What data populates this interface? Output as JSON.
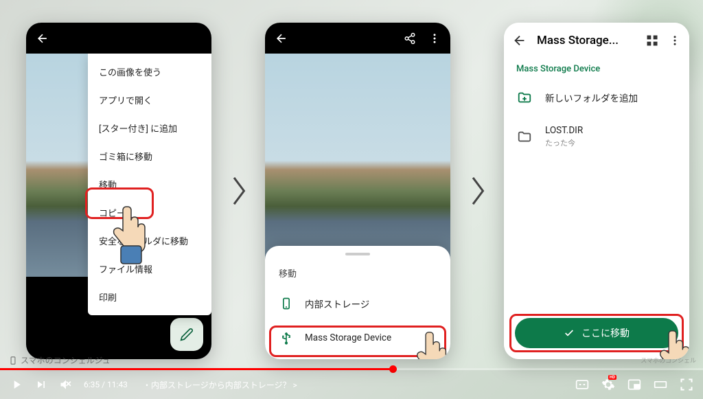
{
  "video": {
    "current_time": "6:35",
    "total_time": "11:43",
    "chapter_title": "・内部ストレージから内部ストレージ？",
    "chapter_marker": ">",
    "watermark": "スマホのコンシェルジュ",
    "branding_right": "スマホのコンシェル"
  },
  "phone1": {
    "menu": {
      "use_image": "この画像を使う",
      "open_with": "アプリで開く",
      "add_star": "[スター付き] に追加",
      "to_trash": "ゴミ箱に移動",
      "move": "移動",
      "copy": "コピー",
      "safe_move": "安全なフォルダに移動",
      "file_info": "ファイル情報",
      "print": "印刷"
    }
  },
  "phone2": {
    "sheet": {
      "title": "移動",
      "internal_storage": "内部ストレージ",
      "mass_storage": "Mass Storage Device"
    }
  },
  "phone3": {
    "title": "Mass Storage...",
    "subtitle": "Mass Storage Device",
    "new_folder": "新しいフォルダを追加",
    "folder_name": "LOST.DIR",
    "folder_time": "たった今",
    "move_button": "ここに移動"
  }
}
